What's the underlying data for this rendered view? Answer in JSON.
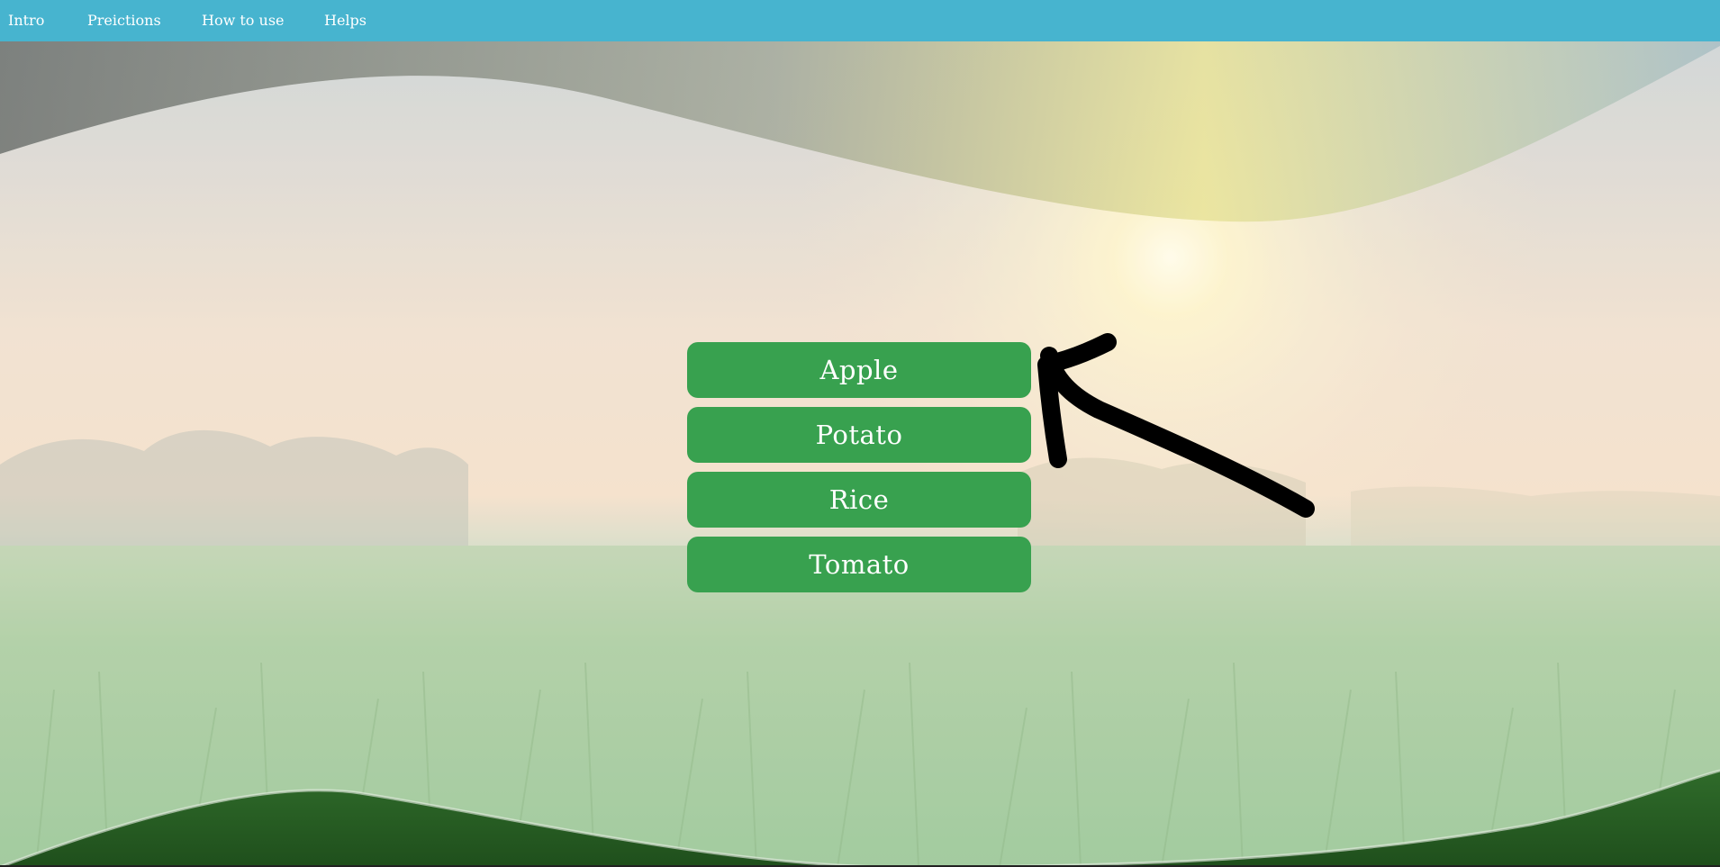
{
  "nav": {
    "items": [
      {
        "label": "Intro"
      },
      {
        "label": "Preictions"
      },
      {
        "label": "How to use"
      },
      {
        "label": "Helps"
      }
    ]
  },
  "crops": {
    "buttons": [
      {
        "label": "Apple"
      },
      {
        "label": "Potato"
      },
      {
        "label": "Rice"
      },
      {
        "label": "Tomato"
      }
    ]
  },
  "colors": {
    "navbar": "#47b4cf",
    "button": "#38a14f",
    "button_text": "#ffffff"
  }
}
